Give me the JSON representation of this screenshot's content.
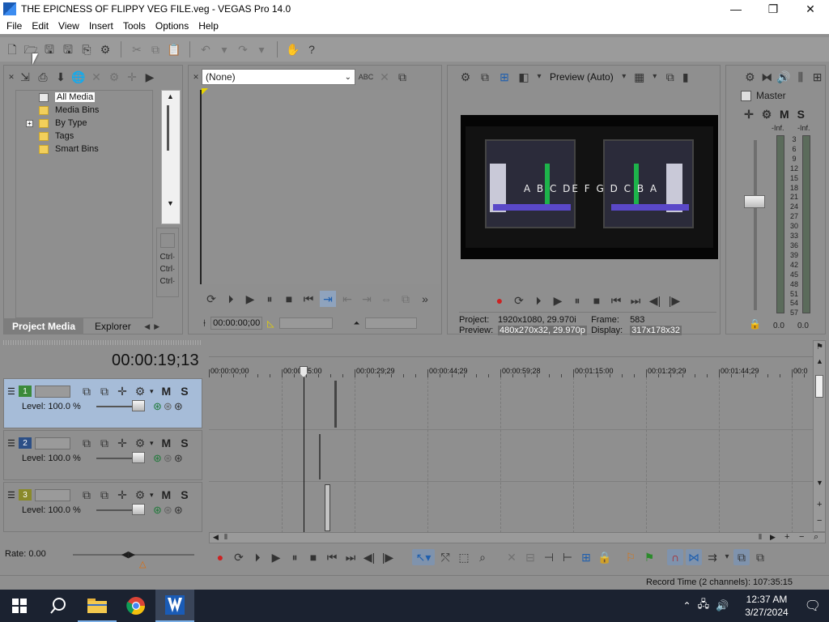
{
  "window": {
    "title": "THE EPICNESS OF FLIPPY VEG FILE.veg - VEGAS Pro 14.0"
  },
  "menu": [
    "File",
    "Edit",
    "View",
    "Insert",
    "Tools",
    "Options",
    "Help"
  ],
  "project_media": {
    "tree": [
      "All Media",
      "Media Bins",
      "By Type",
      "Tags",
      "Smart Bins"
    ],
    "side_labels": [
      "Ctrl·",
      "Ctrl·",
      "Ctrl·"
    ],
    "tabs": [
      "Project Media",
      "Explorer"
    ]
  },
  "trimmer": {
    "selector": "(None)",
    "timecode": "00:00:00;00"
  },
  "preview": {
    "mode": "Preview (Auto)",
    "project_label": "Project:",
    "project_value": "1920x1080, 29.970i",
    "frame_label": "Frame:",
    "frame_value": "583",
    "preview_label": "Preview:",
    "preview_value": "480x270x32, 29.970p",
    "display_label": "Display:",
    "display_value": "317x178x32",
    "screen_letters": "A B C DE F G D C B A"
  },
  "master": {
    "title": "Master",
    "m": "M",
    "s": "S",
    "inf_left": "-Inf.",
    "inf_right": "-Inf.",
    "scale": [
      "3",
      "6",
      "9",
      "12",
      "15",
      "18",
      "21",
      "24",
      "27",
      "30",
      "33",
      "36",
      "39",
      "42",
      "45",
      "48",
      "51",
      "54",
      "57"
    ],
    "zero_left": "0.0",
    "zero_right": "0.0"
  },
  "timeline": {
    "cursor_time": "00:00:19;13",
    "ruler": [
      "00:00:00;00",
      "00:00:15:00",
      "00:00:29;29",
      "00:00:44;29",
      "00:00:59;28",
      "00:01:15:00",
      "00:01:29;29",
      "00:01:44;29",
      "00:0"
    ],
    "tracks": [
      {
        "num": "1",
        "level": "Level: 100.0 %",
        "color": "#3b8a3b",
        "m": "M",
        "s": "S"
      },
      {
        "num": "2",
        "level": "Level: 100.0 %",
        "color": "#2c4f86",
        "m": "M",
        "s": "S"
      },
      {
        "num": "3",
        "level": "Level: 100.0 %",
        "color": "#8a8a2a",
        "m": "M",
        "s": "S"
      }
    ]
  },
  "transport": {
    "rate": "Rate: 0.00"
  },
  "status": {
    "record_time": "Record Time (2 channels): 107:35:15"
  },
  "taskbar": {
    "time": "12:37 AM",
    "date": "3/27/2024"
  }
}
